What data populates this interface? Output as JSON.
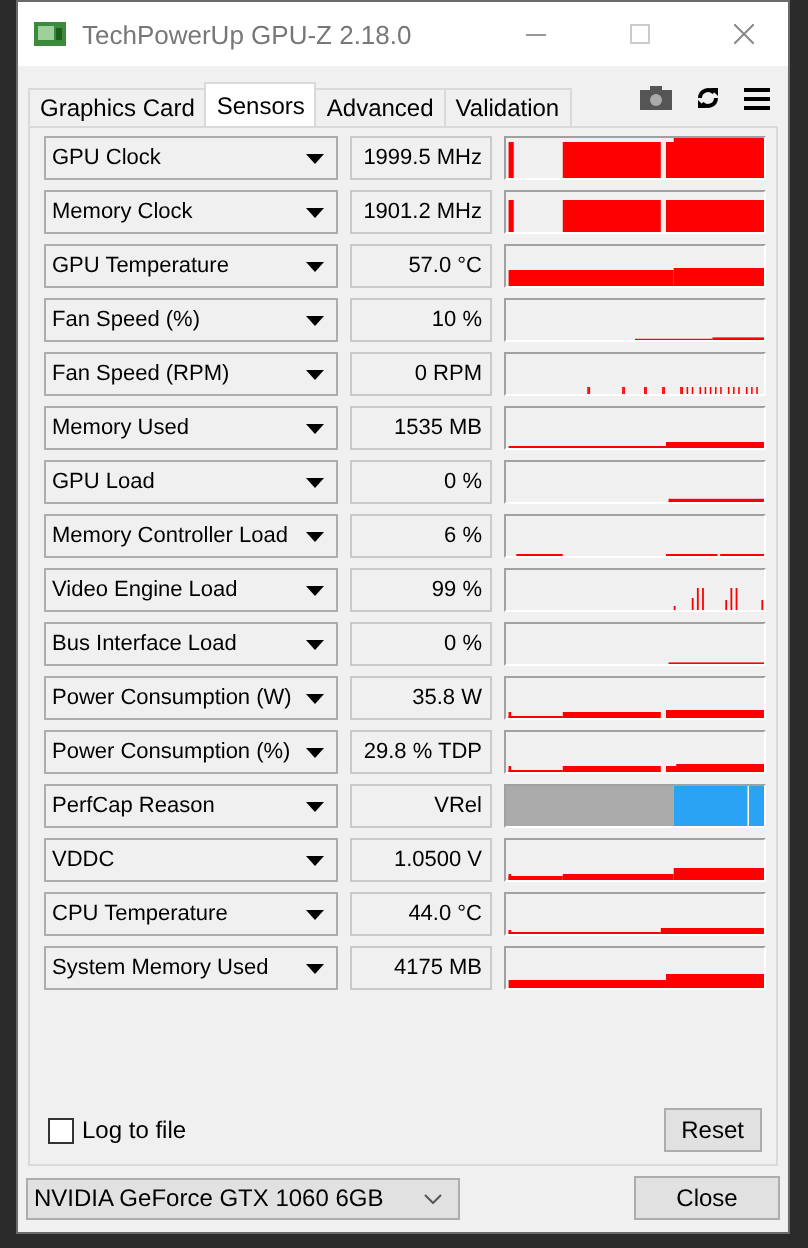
{
  "window": {
    "title": "TechPowerUp GPU-Z 2.18.0"
  },
  "tabs": [
    {
      "label": "Graphics Card",
      "selected": false
    },
    {
      "label": "Sensors",
      "selected": true
    },
    {
      "label": "Advanced",
      "selected": false
    },
    {
      "label": "Validation",
      "selected": false
    }
  ],
  "sensors": [
    {
      "kind": "graph",
      "name": "GPU Clock",
      "reading": "1999.5 MHz"
    },
    {
      "kind": "graph",
      "name": "Memory Clock",
      "reading": "1901.2 MHz"
    },
    {
      "kind": "graph",
      "name": "GPU Temperature",
      "reading": "57.0 °C"
    },
    {
      "kind": "graph",
      "name": "Fan Speed (%)",
      "reading": "10 %"
    },
    {
      "kind": "graph",
      "name": "Fan Speed (RPM)",
      "reading": "0 RPM"
    },
    {
      "kind": "graph",
      "name": "Memory Used",
      "reading": "1535 MB"
    },
    {
      "kind": "graph",
      "name": "GPU Load",
      "reading": "0 %"
    },
    {
      "kind": "graph",
      "name": "Memory Controller Load",
      "reading": "6 %"
    },
    {
      "kind": "graph",
      "name": "Video Engine Load",
      "reading": "99 %"
    },
    {
      "kind": "graph",
      "name": "Bus Interface Load",
      "reading": "0 %"
    },
    {
      "kind": "graph",
      "name": "Power Consumption (W)",
      "reading": "35.8 W"
    },
    {
      "kind": "graph",
      "name": "Power Consumption (%)",
      "reading": "29.8 % TDP"
    },
    {
      "kind": "perfcap",
      "name": "PerfCap Reason",
      "reading": "VRel"
    },
    {
      "kind": "graph",
      "name": "VDDC",
      "reading": "1.0500 V"
    },
    {
      "kind": "graph",
      "name": "CPU Temperature",
      "reading": "44.0 °C"
    },
    {
      "kind": "graph",
      "name": "System Memory Used",
      "reading": "4175 MB"
    }
  ],
  "log_to_file": {
    "label": "Log to file",
    "checked": false
  },
  "reset_button": "Reset",
  "device_select": "NVIDIA GeForce GTX 1060 6GB",
  "close_button": "Close"
}
